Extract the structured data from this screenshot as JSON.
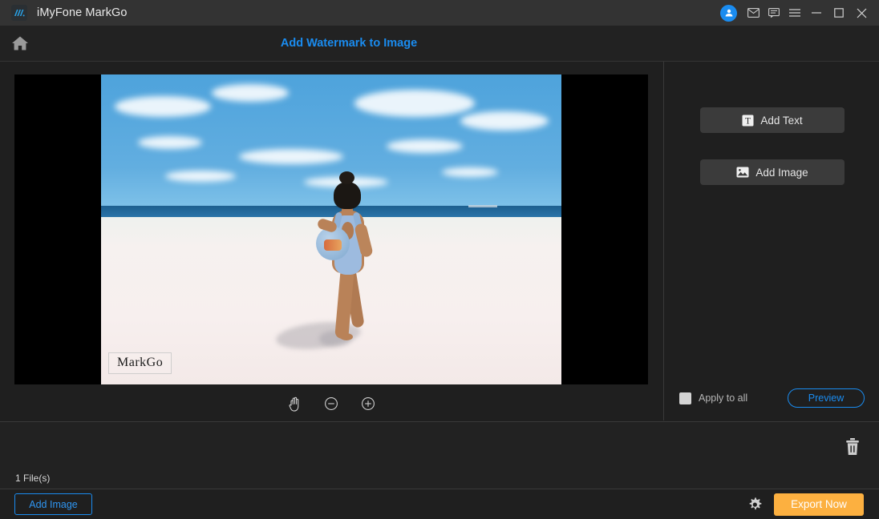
{
  "titlebar": {
    "app_title": "iMyFone MarkGo",
    "logo_icon": "markgo-logo-icon",
    "account_icon": "user-avatar-icon",
    "mail_icon": "envelope-icon",
    "feedback_icon": "speech-bubble-icon",
    "menu_icon": "hamburger-menu-icon",
    "minimize_icon": "minimize-icon",
    "maximize_icon": "maximize-icon",
    "close_icon": "close-icon"
  },
  "header": {
    "home_icon": "home-icon",
    "title": "Add Watermark to Image",
    "accent_color": "#1a8cf0"
  },
  "editor": {
    "watermark_text": "MarkGo",
    "zoom_tools": [
      {
        "icon": "hand-pan-icon",
        "name": "pan-tool"
      },
      {
        "icon": "zoom-out-icon",
        "name": "zoom-out"
      },
      {
        "icon": "zoom-in-icon",
        "name": "zoom-in"
      }
    ],
    "image_description": "Girl in blue swimsuit walking on white sand beach"
  },
  "right_panel": {
    "add_text_label": "Add Text",
    "add_text_icon": "text-box-icon",
    "add_image_label": "Add Image",
    "add_image_icon": "picture-icon",
    "apply_to_all_label": "Apply to all",
    "apply_to_all_checked": false,
    "preview_label": "Preview"
  },
  "filestrip": {
    "delete_icon": "trash-icon",
    "file_count": "1 File(s)"
  },
  "bottombar": {
    "add_image_label": "Add Image",
    "settings_icon": "gear-icon",
    "export_label": "Export Now",
    "export_color": "#fcb040"
  }
}
